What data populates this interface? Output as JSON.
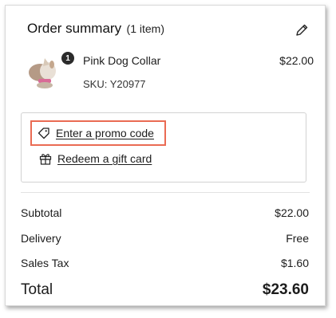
{
  "header": {
    "title": "Order summary",
    "item_count": "(1 item)",
    "edit_icon": "pencil-icon"
  },
  "item": {
    "name": "Pink Dog Collar",
    "sku": "SKU: Y20977",
    "price": "$22.00",
    "quantity": "1"
  },
  "promo": {
    "promo_label": "Enter a promo code",
    "promo_icon": "tag-icon",
    "gift_label": "Redeem a gift card",
    "gift_icon": "gift-icon",
    "highlight_color": "#ea6b53"
  },
  "totals": {
    "subtotal_label": "Subtotal",
    "subtotal_value": "$22.00",
    "delivery_label": "Delivery",
    "delivery_value": "Free",
    "tax_label": "Sales Tax",
    "tax_value": "$1.60",
    "total_label": "Total",
    "total_value": "$23.60"
  }
}
